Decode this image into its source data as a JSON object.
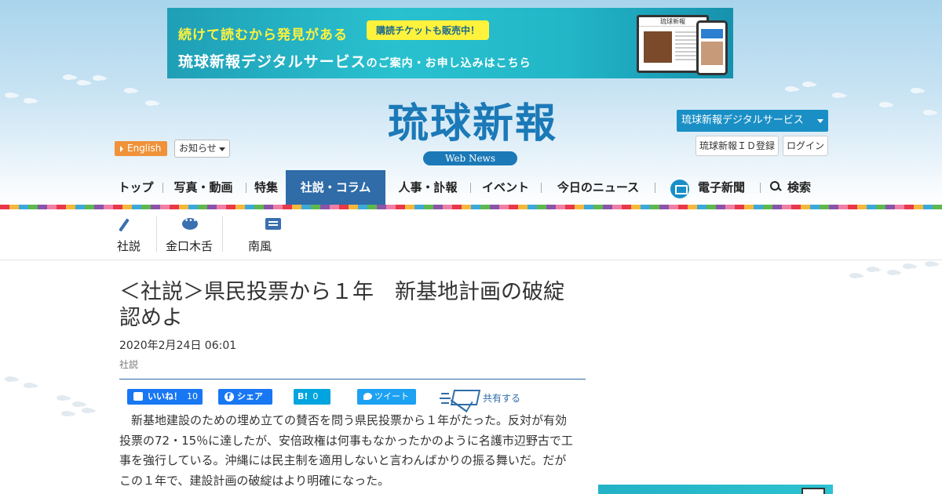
{
  "banner": {
    "line1": "続けて読むから発見がある",
    "tag": "購読チケットも販売中！",
    "line2_main": "琉球新報デジタルサービス",
    "line2_small": "のご案内・お申し込みはこちら",
    "screen_masthead": "琉球新報"
  },
  "header": {
    "logo": "琉球新報",
    "logo_sub": "Web News",
    "english_label": "English",
    "notice_label": "お知らせ",
    "digital_service_label": "琉球新報デジタルサービス",
    "id_register_label": "琉球新報ＩＤ登録",
    "login_label": "ログイン"
  },
  "nav": {
    "items": [
      {
        "label": "トップ"
      },
      {
        "label": "写真・動画"
      },
      {
        "label": "特集"
      },
      {
        "label": "社説・コラム"
      },
      {
        "label": "人事・訃報"
      },
      {
        "label": "イベント"
      },
      {
        "label": "今日のニュース"
      },
      {
        "label": "電子新聞"
      },
      {
        "label": "検索"
      }
    ],
    "active_index": 3
  },
  "subnav": {
    "items": [
      {
        "label": "社説",
        "icon": "pen-icon"
      },
      {
        "label": "金口木舌",
        "icon": "speech-bubble-icon"
      },
      {
        "label": "南風",
        "icon": "memo-icon"
      }
    ]
  },
  "article": {
    "title": "＜社説＞県民投票から１年　新基地計画の破綻認めよ",
    "date": "2020年2月24日 06:01",
    "category": "社説",
    "body": "新基地建設のための埋め立ての賛否を問う県民投票から１年がたった。反対が有効投票の72・15％に達したが、安倍政権は何事もなかったかのように名護市辺野古で工事を強行している。沖縄には民主制を適用しないと言わんばかりの振る舞いだ。だがこの１年で、建設計画の破綻はより明確になった。"
  },
  "share": {
    "like_label": "いいね！",
    "like_count": "10",
    "fb_share_label": "シェア",
    "hatena_label": "B!",
    "hatena_count": "0",
    "tweet_label": "ツイート",
    "share_label": "共有する"
  },
  "colors": {
    "brand_blue": "#1b79b7",
    "nav_active": "#2f6ca8",
    "english_orange": "#f0923a",
    "digital_blue": "#1a8fc6",
    "facebook": "#1877f2",
    "twitter": "#1da1f2",
    "hatena": "#00a4de"
  }
}
